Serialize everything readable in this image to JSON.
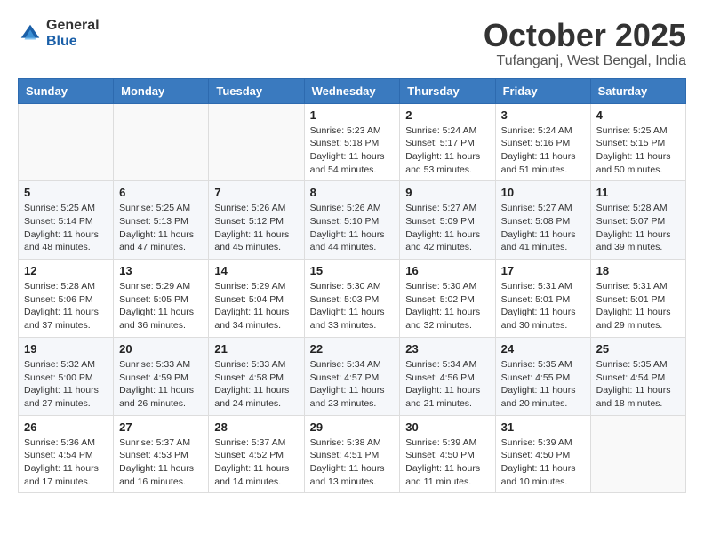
{
  "logo": {
    "general": "General",
    "blue": "Blue"
  },
  "title": {
    "month_year": "October 2025",
    "location": "Tufanganj, West Bengal, India"
  },
  "headers": [
    "Sunday",
    "Monday",
    "Tuesday",
    "Wednesday",
    "Thursday",
    "Friday",
    "Saturday"
  ],
  "weeks": [
    [
      {
        "day": "",
        "info": ""
      },
      {
        "day": "",
        "info": ""
      },
      {
        "day": "",
        "info": ""
      },
      {
        "day": "1",
        "info": "Sunrise: 5:23 AM\nSunset: 5:18 PM\nDaylight: 11 hours\nand 54 minutes."
      },
      {
        "day": "2",
        "info": "Sunrise: 5:24 AM\nSunset: 5:17 PM\nDaylight: 11 hours\nand 53 minutes."
      },
      {
        "day": "3",
        "info": "Sunrise: 5:24 AM\nSunset: 5:16 PM\nDaylight: 11 hours\nand 51 minutes."
      },
      {
        "day": "4",
        "info": "Sunrise: 5:25 AM\nSunset: 5:15 PM\nDaylight: 11 hours\nand 50 minutes."
      }
    ],
    [
      {
        "day": "5",
        "info": "Sunrise: 5:25 AM\nSunset: 5:14 PM\nDaylight: 11 hours\nand 48 minutes."
      },
      {
        "day": "6",
        "info": "Sunrise: 5:25 AM\nSunset: 5:13 PM\nDaylight: 11 hours\nand 47 minutes."
      },
      {
        "day": "7",
        "info": "Sunrise: 5:26 AM\nSunset: 5:12 PM\nDaylight: 11 hours\nand 45 minutes."
      },
      {
        "day": "8",
        "info": "Sunrise: 5:26 AM\nSunset: 5:10 PM\nDaylight: 11 hours\nand 44 minutes."
      },
      {
        "day": "9",
        "info": "Sunrise: 5:27 AM\nSunset: 5:09 PM\nDaylight: 11 hours\nand 42 minutes."
      },
      {
        "day": "10",
        "info": "Sunrise: 5:27 AM\nSunset: 5:08 PM\nDaylight: 11 hours\nand 41 minutes."
      },
      {
        "day": "11",
        "info": "Sunrise: 5:28 AM\nSunset: 5:07 PM\nDaylight: 11 hours\nand 39 minutes."
      }
    ],
    [
      {
        "day": "12",
        "info": "Sunrise: 5:28 AM\nSunset: 5:06 PM\nDaylight: 11 hours\nand 37 minutes."
      },
      {
        "day": "13",
        "info": "Sunrise: 5:29 AM\nSunset: 5:05 PM\nDaylight: 11 hours\nand 36 minutes."
      },
      {
        "day": "14",
        "info": "Sunrise: 5:29 AM\nSunset: 5:04 PM\nDaylight: 11 hours\nand 34 minutes."
      },
      {
        "day": "15",
        "info": "Sunrise: 5:30 AM\nSunset: 5:03 PM\nDaylight: 11 hours\nand 33 minutes."
      },
      {
        "day": "16",
        "info": "Sunrise: 5:30 AM\nSunset: 5:02 PM\nDaylight: 11 hours\nand 32 minutes."
      },
      {
        "day": "17",
        "info": "Sunrise: 5:31 AM\nSunset: 5:01 PM\nDaylight: 11 hours\nand 30 minutes."
      },
      {
        "day": "18",
        "info": "Sunrise: 5:31 AM\nSunset: 5:01 PM\nDaylight: 11 hours\nand 29 minutes."
      }
    ],
    [
      {
        "day": "19",
        "info": "Sunrise: 5:32 AM\nSunset: 5:00 PM\nDaylight: 11 hours\nand 27 minutes."
      },
      {
        "day": "20",
        "info": "Sunrise: 5:33 AM\nSunset: 4:59 PM\nDaylight: 11 hours\nand 26 minutes."
      },
      {
        "day": "21",
        "info": "Sunrise: 5:33 AM\nSunset: 4:58 PM\nDaylight: 11 hours\nand 24 minutes."
      },
      {
        "day": "22",
        "info": "Sunrise: 5:34 AM\nSunset: 4:57 PM\nDaylight: 11 hours\nand 23 minutes."
      },
      {
        "day": "23",
        "info": "Sunrise: 5:34 AM\nSunset: 4:56 PM\nDaylight: 11 hours\nand 21 minutes."
      },
      {
        "day": "24",
        "info": "Sunrise: 5:35 AM\nSunset: 4:55 PM\nDaylight: 11 hours\nand 20 minutes."
      },
      {
        "day": "25",
        "info": "Sunrise: 5:35 AM\nSunset: 4:54 PM\nDaylight: 11 hours\nand 18 minutes."
      }
    ],
    [
      {
        "day": "26",
        "info": "Sunrise: 5:36 AM\nSunset: 4:54 PM\nDaylight: 11 hours\nand 17 minutes."
      },
      {
        "day": "27",
        "info": "Sunrise: 5:37 AM\nSunset: 4:53 PM\nDaylight: 11 hours\nand 16 minutes."
      },
      {
        "day": "28",
        "info": "Sunrise: 5:37 AM\nSunset: 4:52 PM\nDaylight: 11 hours\nand 14 minutes."
      },
      {
        "day": "29",
        "info": "Sunrise: 5:38 AM\nSunset: 4:51 PM\nDaylight: 11 hours\nand 13 minutes."
      },
      {
        "day": "30",
        "info": "Sunrise: 5:39 AM\nSunset: 4:50 PM\nDaylight: 11 hours\nand 11 minutes."
      },
      {
        "day": "31",
        "info": "Sunrise: 5:39 AM\nSunset: 4:50 PM\nDaylight: 11 hours\nand 10 minutes."
      },
      {
        "day": "",
        "info": ""
      }
    ]
  ]
}
